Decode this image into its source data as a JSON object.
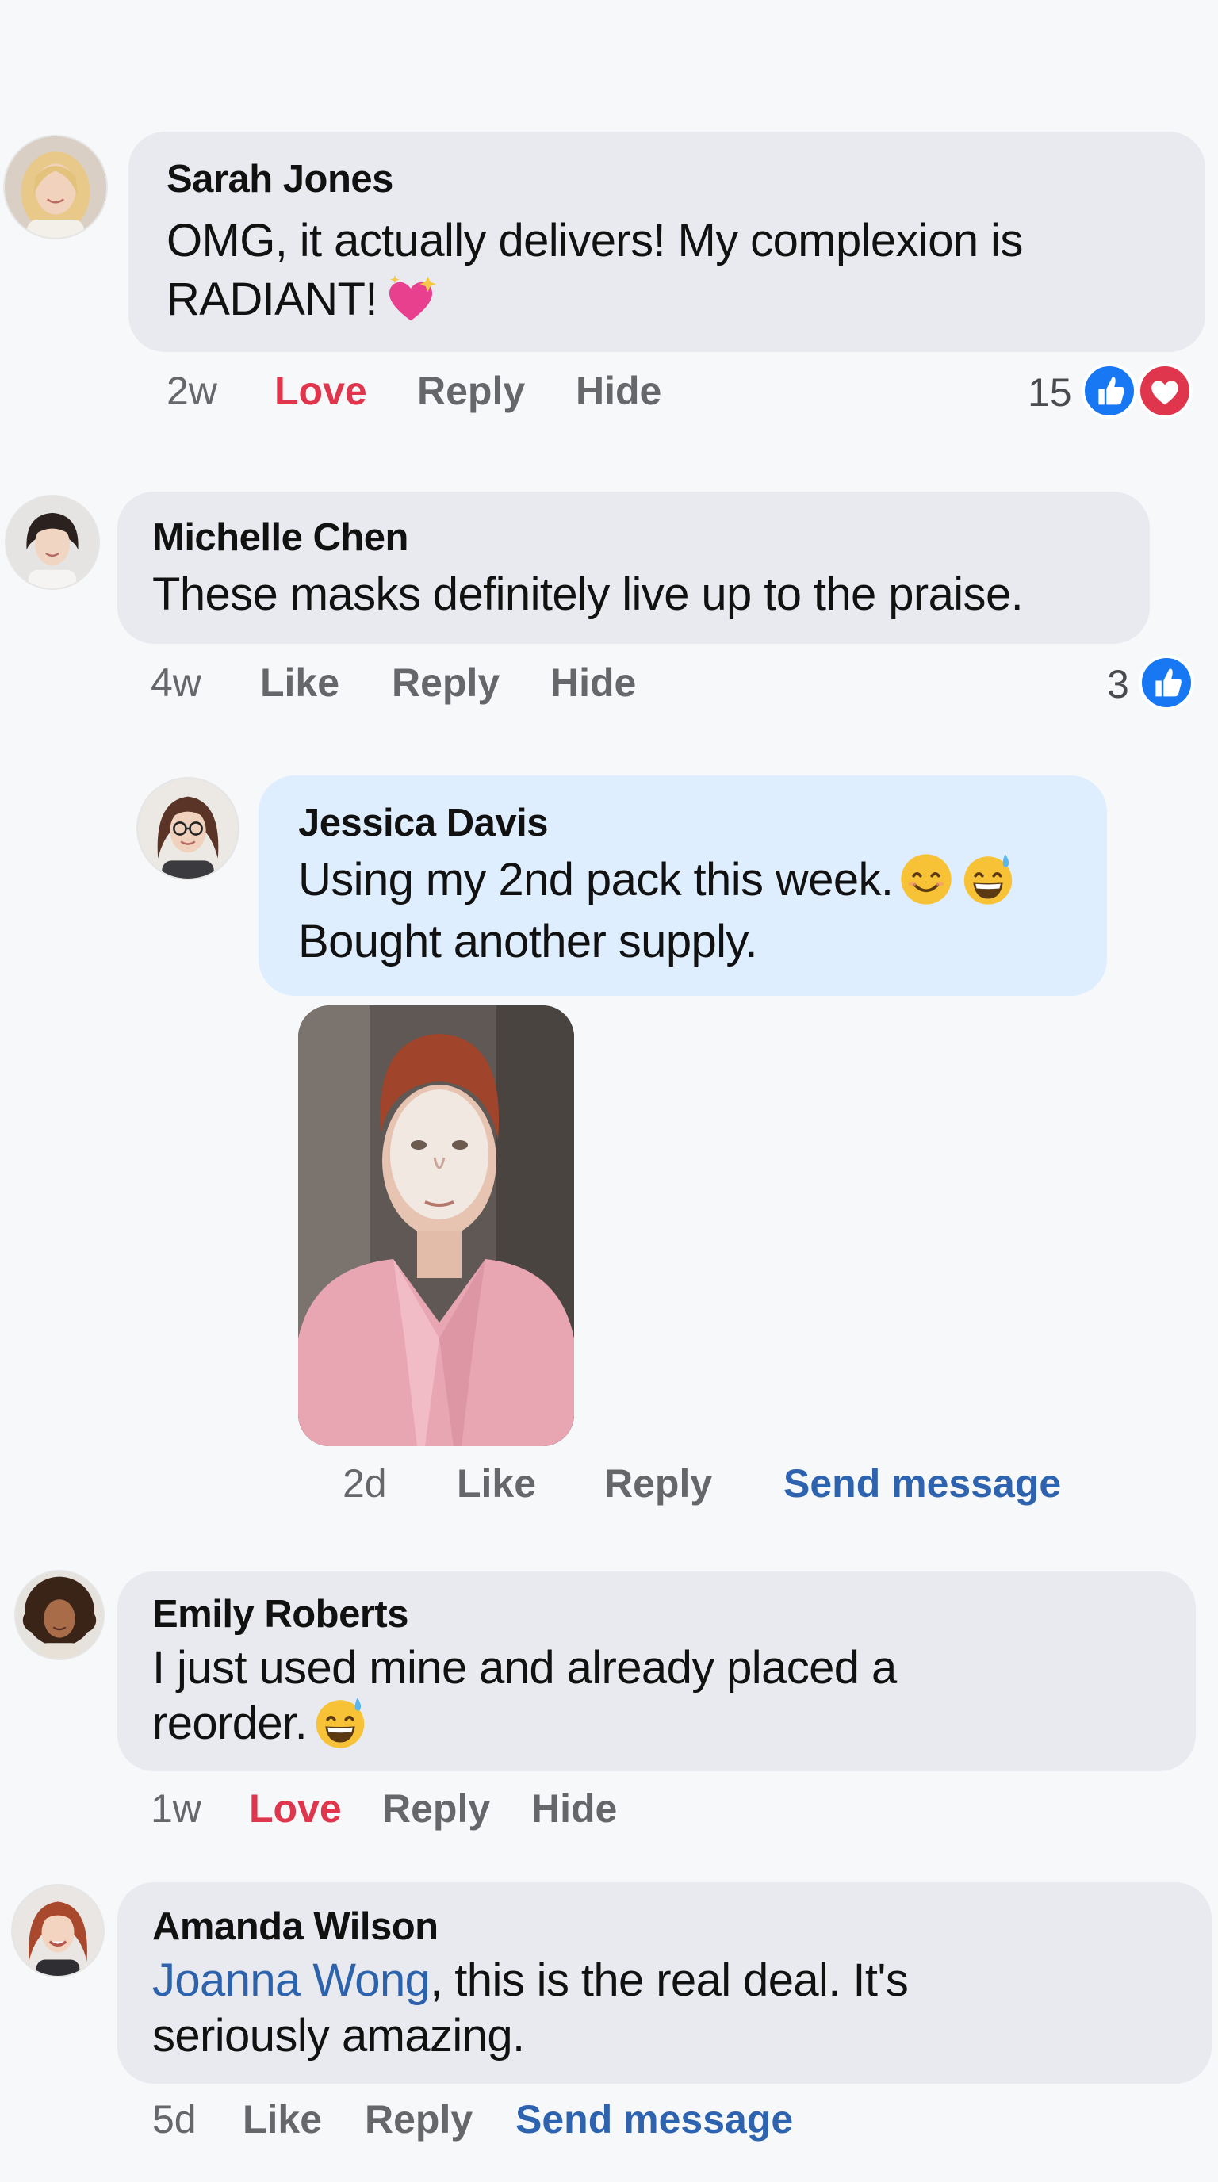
{
  "comments": [
    {
      "name": "Sarah Jones",
      "text_line1": "OMG, it actually delivers! My complexion is",
      "text_line2": "RADIANT!",
      "emoji_line2": "sparkling-heart",
      "time": "2w",
      "action1": "Love",
      "reply": "Reply",
      "hide": "Hide",
      "reaction_count": "15",
      "reactions": [
        "like",
        "love"
      ]
    },
    {
      "name": "Michelle Chen",
      "text_line1": "These masks definitely live up to the praise.",
      "time": "4w",
      "action1": "Like",
      "reply": "Reply",
      "hide": "Hide",
      "reaction_count": "3",
      "reactions": [
        "like"
      ]
    },
    {
      "name": "Jessica Davis",
      "text_line1": "Using my 2nd pack this week.",
      "emoji_line1": [
        "smiling-face",
        "grinning-sweat"
      ],
      "text_line2": "Bought another supply.",
      "photo": "woman-in-pink-robe-wearing-sheet-mask",
      "time": "2d",
      "action1": "Like",
      "reply": "Reply",
      "send_message": "Send message"
    },
    {
      "name": "Emily Roberts",
      "text_line1": "I just used mine and already placed a",
      "text_line2": "reorder.",
      "emoji_line2": "grinning-sweat",
      "time": "1w",
      "action1": "Love",
      "reply": "Reply",
      "hide": "Hide"
    },
    {
      "name": "Amanda Wilson",
      "mention": "Joanna Wong",
      "text_line1_rest": ", this is the real deal. It's",
      "text_line2": "seriously amazing.",
      "time": "5d",
      "action1": "Like",
      "reply": "Reply",
      "send_message": "Send message"
    }
  ],
  "colors": {
    "background": "#f7f8fa",
    "bubble": "#e9eaef",
    "bubble_highlight": "#dfeefe",
    "love": "#e0364d",
    "link": "#2e63b0",
    "meta": "#65676b",
    "like_blue": "#1877f2"
  }
}
